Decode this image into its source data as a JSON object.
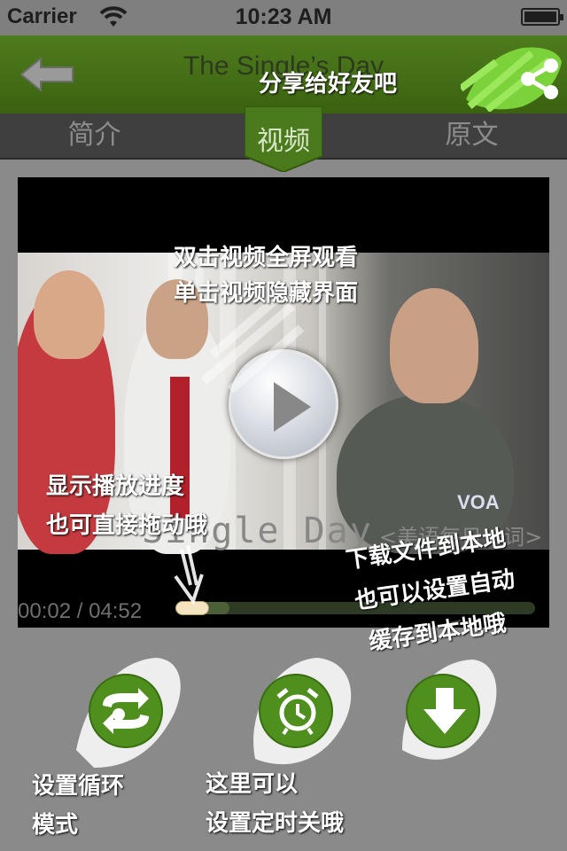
{
  "status_bar": {
    "carrier": "Carrier",
    "time": "10:23 AM"
  },
  "navbar": {
    "title": "The Single’s Day"
  },
  "tabs": [
    {
      "label": "简介"
    },
    {
      "label": "视频"
    },
    {
      "label": "原文"
    }
  ],
  "video": {
    "caption": "Single Day",
    "subcaption": "<美语每日一词>",
    "logo": "VOA",
    "time": "00:02 / 04:52",
    "progress": 0.15
  },
  "hints": {
    "share": "分享给好友吧",
    "fullscreen": [
      "双击视频全屏观看",
      "单击视频隐藏界面"
    ],
    "progress": [
      "显示播放进度",
      "也可直接拖动哦"
    ],
    "download": [
      "下载文件到本地",
      "也可以设置自动",
      "缓存到本地哦"
    ],
    "loop": [
      "设置循环",
      "模式"
    ],
    "timer": [
      "这里可以",
      "设置定时关哦"
    ]
  },
  "colors": {
    "nav_green": "#4f7c1d",
    "button_green": "#4e8f1d",
    "tab_bg": "#3f3f3f"
  },
  "icons": [
    "back-arrow-icon",
    "share-icon",
    "play-icon",
    "loop-icon",
    "alarm-clock-icon",
    "download-icon"
  ]
}
